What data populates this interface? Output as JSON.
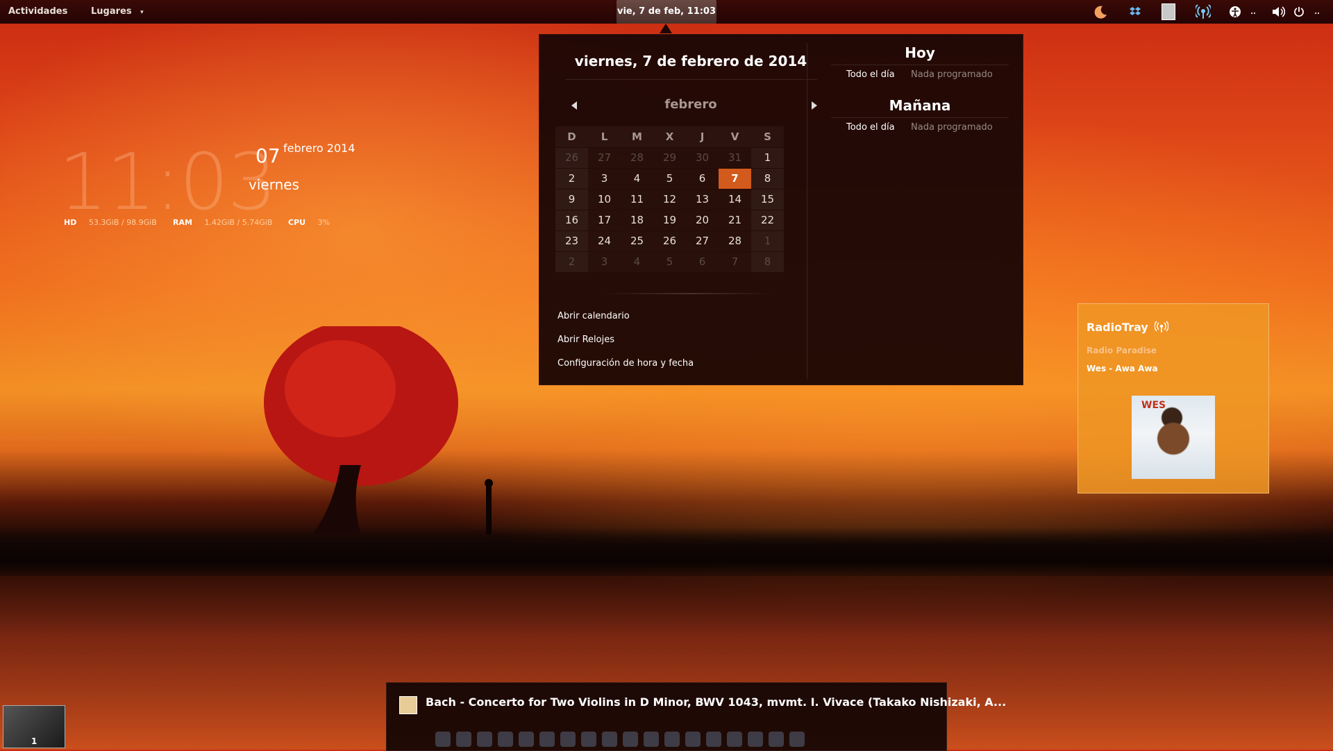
{
  "topbar": {
    "activities": "Actividades",
    "places": "Lugares",
    "clock": "vie, 7 de feb, 11:03",
    "tray_icons": [
      "moon-icon",
      "dropbox-icon",
      "user-icon",
      "radio-icon",
      "accessibility-icon",
      "volume-icon",
      "power-icon"
    ]
  },
  "calendar": {
    "date_title": "viernes,  7 de febrero de 2014",
    "month": "febrero",
    "weekdays": [
      "D",
      "L",
      "M",
      "X",
      "J",
      "V",
      "S"
    ],
    "weeks": [
      [
        "26",
        "27",
        "28",
        "29",
        "30",
        "31",
        "1"
      ],
      [
        "2",
        "3",
        "4",
        "5",
        "6",
        "7",
        "8"
      ],
      [
        "9",
        "10",
        "11",
        "12",
        "13",
        "14",
        "15"
      ],
      [
        "16",
        "17",
        "18",
        "19",
        "20",
        "21",
        "22"
      ],
      [
        "23",
        "24",
        "25",
        "26",
        "27",
        "28",
        "1"
      ],
      [
        "2",
        "3",
        "4",
        "5",
        "6",
        "7",
        "8"
      ]
    ],
    "today": "7",
    "menu": [
      "Abrir calendario",
      "Abrir Relojes",
      "Configuración de hora y fecha"
    ]
  },
  "events": {
    "today_title": "Hoy",
    "tomorrow_title": "Mañana",
    "all_day": "Todo el día",
    "nothing": "Nada programado"
  },
  "clock_widget": {
    "time": "11:03",
    "day_num": "07",
    "month_year": "febrero 2014",
    "weekday": "viernes",
    "hd_label": "HD",
    "hd_value": "53.3GiB / 98.9GiB",
    "ram_label": "RAM",
    "ram_value": "1.42GiB / 5.74GiB",
    "cpu_label": "CPU",
    "cpu_value": "3%"
  },
  "radiotray": {
    "title": "RadioTray",
    "station": "Radio Paradise",
    "song": "Wes - Awa Awa",
    "art_logo": "WES"
  },
  "notification": {
    "text": "Bach - Concerto for Two Violins in D Minor, BWV 1043, mvmt. I. Vivace (Takako Nishizaki, A..."
  },
  "workspace": {
    "number": "1"
  }
}
